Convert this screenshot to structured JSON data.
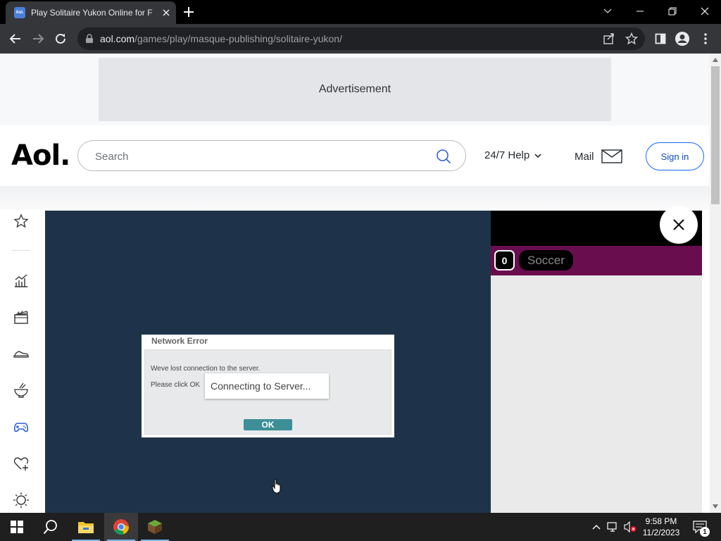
{
  "browser": {
    "tab_title": "Play Solitaire Yukon Online for F",
    "favicon_text": "Aol.",
    "url_host": "aol.com",
    "url_path": "/games/play/masque-publishing/solitaire-yukon/"
  },
  "ad": {
    "label": "Advertisement"
  },
  "header": {
    "logo": "Aol.",
    "search_placeholder": "Search",
    "help_label": "24/7 Help",
    "mail_label": "Mail",
    "signin_label": "Sign in"
  },
  "rail": {
    "icons": [
      "star-icon",
      "chart-icon",
      "clapperboard-icon",
      "shoe-icon",
      "bowl-icon",
      "gamepad-icon",
      "heart-plus-icon",
      "sun-icon"
    ]
  },
  "dialog": {
    "title": "Network Error",
    "line1": "Weve lost connection to the server.",
    "line2": "Please click OK",
    "connecting": "Connecting to Server...",
    "ok_label": "OK"
  },
  "right_panel": {
    "score": "0",
    "sport": "Soccer"
  },
  "taskbar": {
    "time": "9:58 PM",
    "date": "11/2/2023",
    "notification_count": "1"
  },
  "colors": {
    "game_bg": "#1e3349",
    "panel_bar": "#6a0d4f",
    "ok_button": "#3d8f97",
    "signin_border": "#0f69ff"
  }
}
